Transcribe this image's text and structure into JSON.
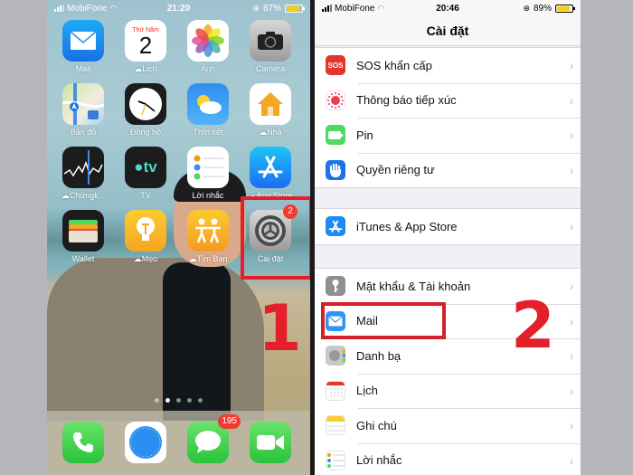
{
  "phone1": {
    "status": {
      "carrier": "MobiFone",
      "time": "21:20",
      "battery": "87%",
      "battery_level": 0.87
    },
    "apps": [
      {
        "label": "Mail",
        "icon": "mail-icon",
        "color": "#1e8cf0"
      },
      {
        "label": "Lịch",
        "icon": "calendar-icon",
        "day_name": "Thứ Năm",
        "day_num": "2",
        "cloud": true
      },
      {
        "label": "Ảnh",
        "icon": "photos-icon"
      },
      {
        "label": "Camera",
        "icon": "camera-icon"
      },
      {
        "label": "Bản đồ",
        "icon": "maps-icon"
      },
      {
        "label": "Đồng hồ",
        "icon": "clock-icon"
      },
      {
        "label": "Thời tiết",
        "icon": "weather-icon"
      },
      {
        "label": "Nhà",
        "icon": "home-icon",
        "cloud": true
      },
      {
        "label": "Chứngk...",
        "icon": "stocks-icon",
        "cloud": true
      },
      {
        "label": "TV",
        "icon": "tv-icon",
        "glyph": "tv"
      },
      {
        "label": "Lời nhắc",
        "icon": "reminders-icon"
      },
      {
        "label": "App Store",
        "icon": "app-store-icon",
        "cloud": true
      },
      {
        "label": "Wallet",
        "icon": "wallet-icon"
      },
      {
        "label": "Mẹo",
        "icon": "tips-icon",
        "cloud": true
      },
      {
        "label": "Tìm Bạn",
        "icon": "find-friends-icon",
        "cloud": true
      },
      {
        "label": "Cài đặt",
        "icon": "settings-icon",
        "badge": "2"
      }
    ],
    "page_dots": {
      "count": 5,
      "active": 1
    },
    "dock": [
      {
        "name": "phone",
        "icon": "phone-icon"
      },
      {
        "name": "safari",
        "icon": "safari-icon"
      },
      {
        "name": "messages",
        "icon": "messages-icon",
        "badge": "195"
      },
      {
        "name": "facetime",
        "icon": "facetime-icon"
      }
    ],
    "step_number": "1"
  },
  "phone2": {
    "status": {
      "carrier": "MobiFone",
      "time": "20:46",
      "battery": "89%",
      "battery_level": 0.89
    },
    "title": "Cài đặt",
    "groups": [
      [
        {
          "label": "SOS khẩn cấp",
          "icon": "sos-icon",
          "icon_text": "SOS",
          "color": "#e5342c"
        },
        {
          "label": "Thông báo tiếp xúc",
          "icon": "exposure-notification-icon",
          "color": "#ffffff"
        },
        {
          "label": "Pin",
          "icon": "battery-icon",
          "color": "#4cd964"
        },
        {
          "label": "Quyền riêng tư",
          "icon": "privacy-hand-icon",
          "color": "#1c73e8"
        }
      ],
      [
        {
          "label": "iTunes & App Store",
          "icon": "app-store-icon",
          "color": "#1a8cf2"
        }
      ],
      [
        {
          "label": "Mật khẩu & Tài khoản",
          "icon": "key-icon",
          "color": "#8e8e93"
        },
        {
          "label": "Mail",
          "icon": "mail-icon",
          "color": "#2f95f2"
        },
        {
          "label": "Danh bạ",
          "icon": "contacts-icon",
          "color": "#b9b9b9"
        },
        {
          "label": "Lịch",
          "icon": "calendar-icon",
          "color": "#ffffff"
        },
        {
          "label": "Ghi chú",
          "icon": "notes-icon",
          "color": "#ffffff"
        },
        {
          "label": "Lời nhắc",
          "icon": "reminders-icon",
          "color": "#ffffff"
        }
      ]
    ],
    "step_number": "2"
  },
  "colors": {
    "highlight": "#e3202a",
    "chevron": "#c4c4c9"
  }
}
